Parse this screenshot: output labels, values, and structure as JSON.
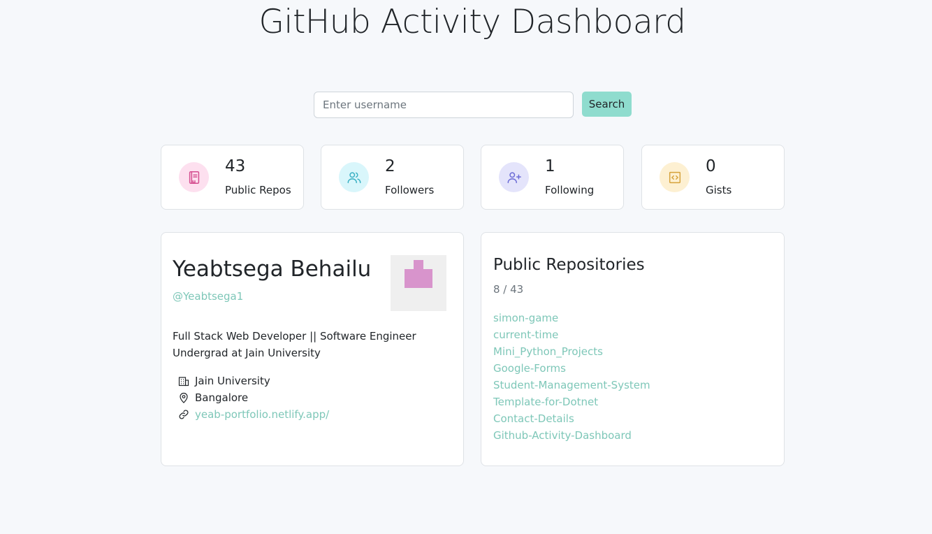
{
  "header": {
    "title": "GitHub Activity Dashboard"
  },
  "search": {
    "placeholder": "Enter username",
    "value": "",
    "button_label": "Search"
  },
  "stats": [
    {
      "value": "43",
      "label": "Public Repos",
      "icon": "book-icon",
      "color": "#d44d8f",
      "bg": "#fde0ef"
    },
    {
      "value": "2",
      "label": "Followers",
      "icon": "users-icon",
      "color": "#3ab0c4",
      "bg": "#d9f6fb"
    },
    {
      "value": "1",
      "label": "Following",
      "icon": "user-plus-icon",
      "color": "#6b6bd6",
      "bg": "#e4e4fb"
    },
    {
      "value": "0",
      "label": "Gists",
      "icon": "code-file-icon",
      "color": "#d6a23a",
      "bg": "#fdf0d2"
    }
  ],
  "profile": {
    "name": "Yeabtsega Behailu",
    "handle": "@Yeabtsega1",
    "bio_line1": "Full Stack Web Developer || Software Engineer",
    "bio_line2": "Undergrad at Jain University",
    "company": "Jain University",
    "location": "Bangalore",
    "website": "yeab-portfolio.netlify.app/",
    "avatar_color": "#d894cc"
  },
  "repositories": {
    "title": "Public Repositories",
    "count": "8 / 43",
    "items": [
      "simon-game",
      "current-time",
      "Mini_Python_Projects",
      "Google-Forms",
      "Student-Management-System",
      "Template-for-Dotnet",
      "Contact-Details",
      "Github-Activity-Dashboard"
    ]
  },
  "colors": {
    "accent": "#8fdcce",
    "link": "#7ec7b8",
    "background": "#f6f8fb"
  }
}
